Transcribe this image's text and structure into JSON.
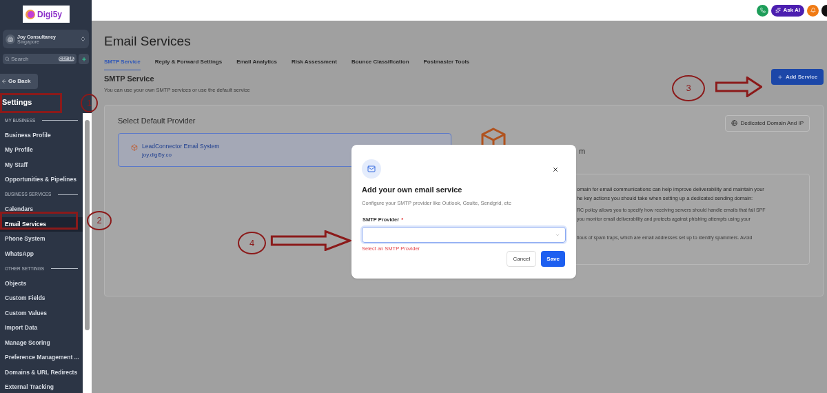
{
  "sidebar": {
    "logo": "Digi5y",
    "account": {
      "name": "Joy Consultancy",
      "location": "Singapore"
    },
    "search": {
      "placeholder": "Search",
      "shortcut": "ctrlK"
    },
    "back_button": "Go Back",
    "heading": "Settings",
    "sections": [
      {
        "title": "MY BUSINESS",
        "items": [
          {
            "label": "Business Profile",
            "selected": false
          },
          {
            "label": "My Profile",
            "selected": false
          },
          {
            "label": "My Staff",
            "selected": false
          },
          {
            "label": "Opportunities & Pipelines",
            "selected": false
          }
        ]
      },
      {
        "title": "BUSINESS SERVICES",
        "items": [
          {
            "label": "Calendars",
            "selected": false
          },
          {
            "label": "Email Services",
            "selected": true
          },
          {
            "label": "Phone System",
            "selected": false
          },
          {
            "label": "WhatsApp",
            "selected": false
          }
        ]
      },
      {
        "title": "OTHER SETTINGS",
        "items": [
          {
            "label": "Objects",
            "selected": false
          },
          {
            "label": "Custom Fields",
            "selected": false
          },
          {
            "label": "Custom Values",
            "selected": false
          },
          {
            "label": "Import Data",
            "selected": false
          },
          {
            "label": "Manage Scoring",
            "selected": false
          },
          {
            "label": "Preference Management ...",
            "selected": false
          },
          {
            "label": "Domains & URL Redirects",
            "selected": false
          },
          {
            "label": "External Tracking",
            "selected": false
          }
        ]
      }
    ]
  },
  "topbar": {
    "ask_ai": "Ask AI"
  },
  "page": {
    "title": "Email Services",
    "tabs": [
      {
        "label": "SMTP Service",
        "selected": true
      },
      {
        "label": "Reply & Forward Settings",
        "selected": false
      },
      {
        "label": "Email Analytics",
        "selected": false
      },
      {
        "label": "Risk Assessment",
        "selected": false
      },
      {
        "label": "Bounce Classification",
        "selected": false
      },
      {
        "label": "Postmaster Tools",
        "selected": false
      }
    ],
    "section_title": "SMTP Service",
    "section_subtitle": "You can use your own SMTP services or use the default service",
    "add_button": "Add Service",
    "card": {
      "title": "Select Default Provider",
      "provider": {
        "name": "LeadConnector Email System",
        "domain": "joy.digi5y.co"
      },
      "dedicated_button": "Dedicated Domain And IP",
      "info_title_fragment": "m",
      "info_lines": [
        "omain for email communications can help improve deliverability and maintain your",
        "he key actions you should take when setting up a dedicated sending domain:"
      ],
      "info_points": [
        "RC policy allows you to specify how receiving servers should handle emails that fail SPF",
        "you monitor email deliverability and protects against phishing attempts using your",
        "tious of spam traps, which are email addresses set up to identify spammers. Avoid"
      ]
    }
  },
  "modal": {
    "title": "Add your own email service",
    "description": "Configure your SMTP provider like Outlook, Gsuite, Sendgrid, etc",
    "field_label": "SMTP Provider",
    "required_mark": "*",
    "error": "Select an SMTP Provider",
    "cancel": "Cancel",
    "save": "Save"
  },
  "annotations": [
    {
      "number": "1"
    },
    {
      "number": "2"
    },
    {
      "number": "3"
    },
    {
      "number": "4"
    }
  ]
}
